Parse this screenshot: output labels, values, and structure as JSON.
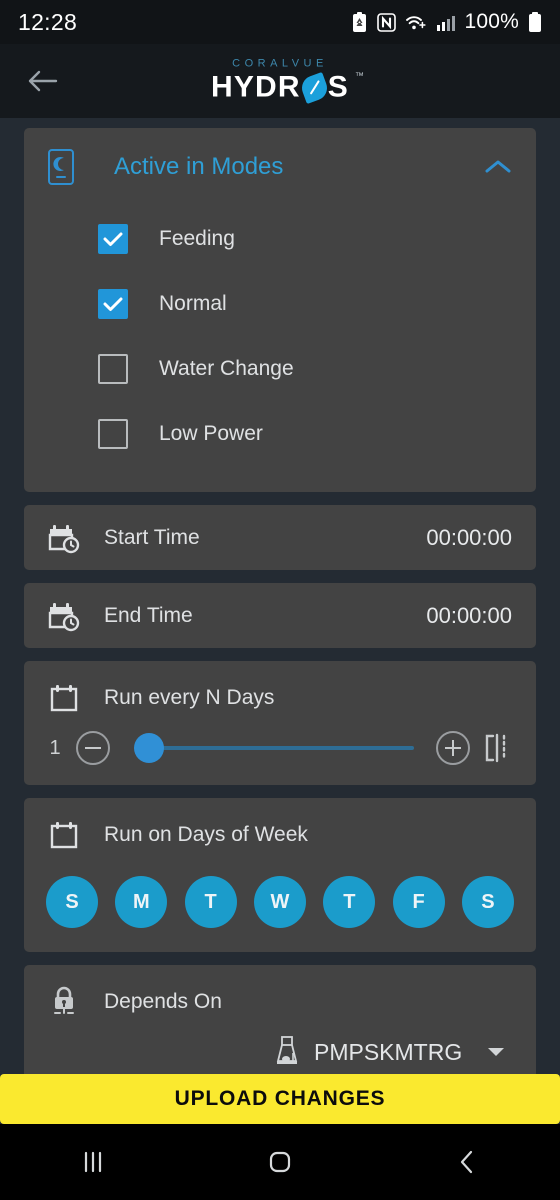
{
  "status_bar": {
    "time": "12:28",
    "battery_percent": "100%",
    "icons": [
      "battery-saver-icon",
      "nfc-icon",
      "wifi-icon",
      "cellular-signal-icon",
      "battery-icon"
    ]
  },
  "app_bar": {
    "back_icon": "back-arrow-icon",
    "brand_top": "CORALVUE",
    "brand_main_left": "HYDR",
    "brand_main_right": "S",
    "brand_tm": "™"
  },
  "modes_card": {
    "icon": "device-mode-icon",
    "title": "Active in Modes",
    "collapse_icon": "chevron-up-icon",
    "items": [
      {
        "label": "Feeding",
        "checked": true
      },
      {
        "label": "Normal",
        "checked": true
      },
      {
        "label": "Water Change",
        "checked": false
      },
      {
        "label": "Low Power",
        "checked": false
      }
    ]
  },
  "start_time": {
    "icon": "calendar-clock-icon",
    "label": "Start Time",
    "value": "00:00:00"
  },
  "end_time": {
    "icon": "calendar-clock-icon",
    "label": "End Time",
    "value": "00:00:00"
  },
  "run_every_n_days": {
    "icon": "calendar-icon",
    "title": "Run every N Days",
    "value": "1",
    "decrement_icon": "minus-circle-icon",
    "increment_icon": "plus-circle-icon",
    "snap_icon": "align-offset-icon",
    "slider_min": 1,
    "slider_max": 30,
    "slider_position_percent": 0
  },
  "run_on_days_of_week": {
    "icon": "calendar-icon",
    "title": "Run on Days of Week",
    "days": [
      {
        "label": "S",
        "active": true
      },
      {
        "label": "M",
        "active": true
      },
      {
        "label": "T",
        "active": true
      },
      {
        "label": "W",
        "active": true
      },
      {
        "label": "T",
        "active": true
      },
      {
        "label": "F",
        "active": true
      },
      {
        "label": "S",
        "active": true
      }
    ]
  },
  "depends_on": {
    "icon": "lock-dependency-icon",
    "title": "Depends On",
    "device_icon": "protein-skimmer-icon",
    "selected": "PMPSKMTRG",
    "caret_icon": "caret-down-icon"
  },
  "upload_button": {
    "label": "UPLOAD CHANGES"
  },
  "nav_bar": {
    "recents_icon": "recent-apps-icon",
    "home_icon": "home-icon",
    "back_icon": "nav-back-icon"
  },
  "colors": {
    "background": "#242b33",
    "card": "#434343",
    "accent_blue": "#2f9fd6",
    "day_circle": "#1b9ccb",
    "upload_yellow": "#fae92f",
    "app_bar": "#15191d"
  }
}
